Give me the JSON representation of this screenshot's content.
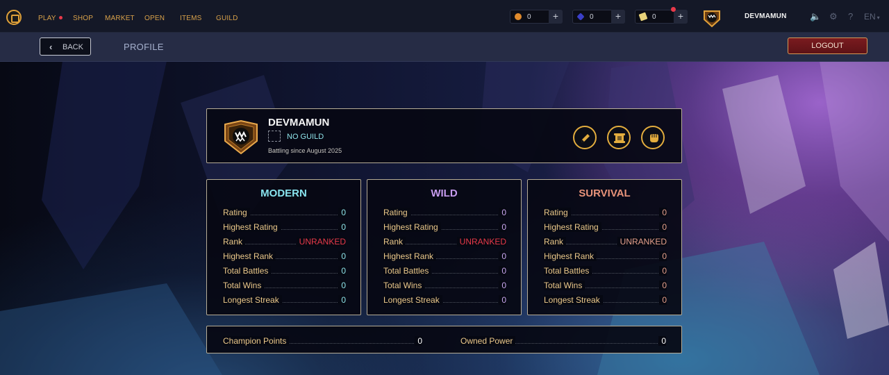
{
  "nav": {
    "items": [
      {
        "label": "PLAY",
        "has_dot": true
      },
      {
        "label": "SHOP"
      },
      {
        "label": "MARKET"
      },
      {
        "label": "OPEN"
      },
      {
        "label": "ITEMS"
      },
      {
        "label": "GUILD"
      }
    ]
  },
  "currencies": [
    {
      "icon": "coin-icon",
      "value": "0",
      "color": "#e08a2c"
    },
    {
      "icon": "gem-icon",
      "value": "0",
      "color": "#3a3fc8"
    },
    {
      "icon": "ticket-icon",
      "value": "0",
      "color": "#e8d27a"
    }
  ],
  "user": {
    "name": "DEVMAMUN"
  },
  "lang": {
    "code": "EN"
  },
  "subbar": {
    "back_label": "BACK",
    "title": "PROFILE",
    "logout_label": "LOGOUT"
  },
  "profile": {
    "name": "DEVMAMUN",
    "guild": "NO GUILD",
    "since": "Battling since August 2025",
    "actions": [
      "edit-icon",
      "scroll-icon",
      "fist-icon"
    ]
  },
  "formats": [
    {
      "title": "MODERN",
      "color": "#88e3ee",
      "rows": [
        {
          "label": "Rating",
          "value": "0"
        },
        {
          "label": "Highest Rating",
          "value": "0"
        },
        {
          "label": "Rank",
          "value": "UNRANKED"
        },
        {
          "label": "Highest Rank",
          "value": "0"
        },
        {
          "label": "Total Battles",
          "value": "0"
        },
        {
          "label": "Total Wins",
          "value": "0"
        },
        {
          "label": "Longest Streak",
          "value": "0"
        }
      ]
    },
    {
      "title": "WILD",
      "color": "#c79cf0",
      "rows": [
        {
          "label": "Rating",
          "value": "0"
        },
        {
          "label": "Highest Rating",
          "value": "0"
        },
        {
          "label": "Rank",
          "value": "UNRANKED"
        },
        {
          "label": "Highest Rank",
          "value": "0"
        },
        {
          "label": "Total Battles",
          "value": "0"
        },
        {
          "label": "Total Wins",
          "value": "0"
        },
        {
          "label": "Longest Streak",
          "value": "0"
        }
      ]
    },
    {
      "title": "SURVIVAL",
      "color": "#e8937a",
      "rows": [
        {
          "label": "Rating",
          "value": "0"
        },
        {
          "label": "Highest Rating",
          "value": "0"
        },
        {
          "label": "Rank",
          "value": "UNRANKED"
        },
        {
          "label": "Highest Rank",
          "value": "0"
        },
        {
          "label": "Total Battles",
          "value": "0"
        },
        {
          "label": "Total Wins",
          "value": "0"
        },
        {
          "label": "Longest Streak",
          "value": "0"
        }
      ]
    }
  ],
  "totals": {
    "champion_points_label": "Champion Points",
    "champion_points": "0",
    "owned_power_label": "Owned Power",
    "owned_power": "0"
  }
}
